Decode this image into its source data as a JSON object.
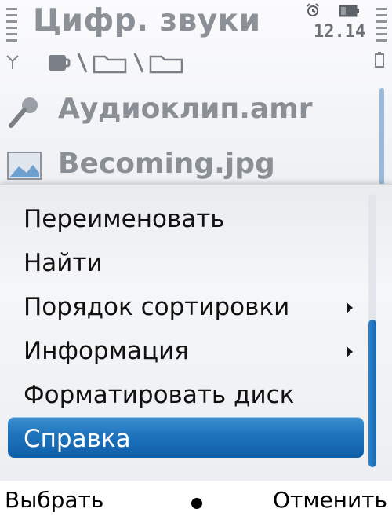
{
  "status": {
    "title": "Цифр. звуки",
    "clock": "12.14"
  },
  "icons": {
    "signal": "signal-strength-icon",
    "battery": "battery-icon",
    "alarm": "alarm-icon",
    "antenna": "antenna-icon",
    "path": [
      "memory-card-icon",
      "folder-icon",
      "folder-icon"
    ]
  },
  "files": [
    {
      "name": "Аудиоклип.amr",
      "icon": "microphone-icon"
    },
    {
      "name": "Becoming.jpg",
      "icon": "image-icon"
    }
  ],
  "menu": {
    "items": [
      {
        "label": "Переименовать",
        "submenu": false
      },
      {
        "label": "Найти",
        "submenu": false
      },
      {
        "label": "Порядок сортировки",
        "submenu": true
      },
      {
        "label": "Информация",
        "submenu": true
      },
      {
        "label": "Форматировать диск",
        "submenu": false
      },
      {
        "label": "Справка",
        "submenu": false,
        "selected": true
      }
    ]
  },
  "softkeys": {
    "left": "Выбрать",
    "right": "Отменить"
  },
  "colors": {
    "highlight": "#1f73bd",
    "title_text": "#8c9197",
    "menu_text": "#111111"
  }
}
